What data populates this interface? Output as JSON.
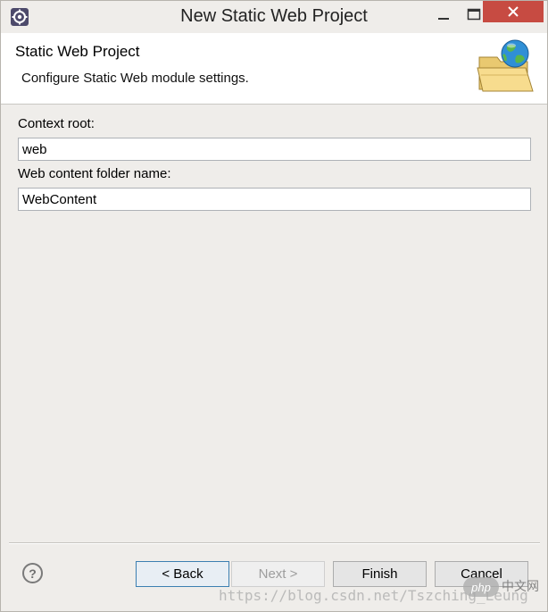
{
  "window": {
    "title": "New Static Web Project",
    "close_color": "#c74b42"
  },
  "banner": {
    "title": "Static Web Project",
    "description": "Configure Static Web module settings.",
    "image_icon": "folder-globe-icon"
  },
  "form": {
    "context_root_label": "Context root:",
    "context_root_value": "web",
    "content_folder_label": "Web content folder name:",
    "content_folder_value": "WebContent"
  },
  "buttons": {
    "back": "< Back",
    "next": "Next >",
    "finish": "Finish",
    "cancel": "Cancel",
    "help_icon": "?"
  },
  "watermark": {
    "url": "https://blog.csdn.net/Tszching_Leung",
    "logo": "php",
    "site": "中文网"
  }
}
